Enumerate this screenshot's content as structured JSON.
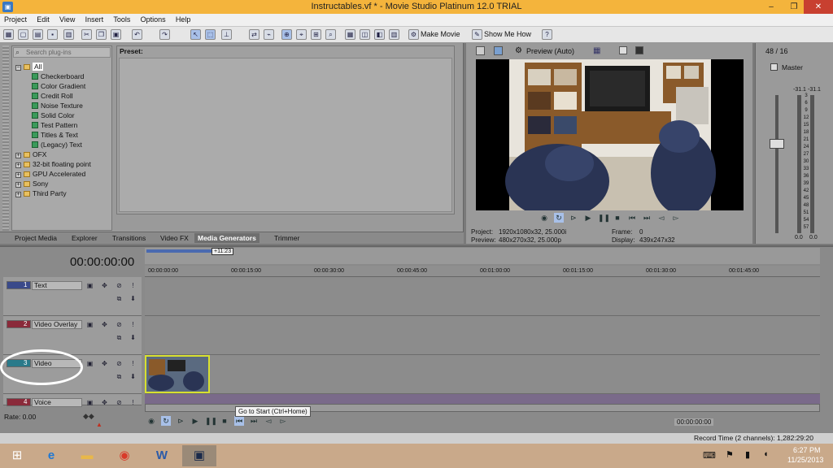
{
  "window": {
    "title": "Instructables.vf * - Movie Studio Platinum 12.0 TRIAL",
    "controls": [
      "–",
      "❐",
      "✕"
    ]
  },
  "menu": [
    "Project",
    "Edit",
    "View",
    "Insert",
    "Tools",
    "Options",
    "Help"
  ],
  "toolbar": {
    "make_movie": "Make Movie",
    "show_me_how": "Show Me How"
  },
  "plugins": {
    "search_placeholder": "Search plug-ins",
    "tree": [
      {
        "label": "All",
        "level": 0,
        "type": "folder",
        "selected": true
      },
      {
        "label": "Checkerboard",
        "level": 1,
        "type": "generator"
      },
      {
        "label": "Color Gradient",
        "level": 1,
        "type": "generator"
      },
      {
        "label": "Credit Roll",
        "level": 1,
        "type": "generator"
      },
      {
        "label": "Noise Texture",
        "level": 1,
        "type": "generator"
      },
      {
        "label": "Solid Color",
        "level": 1,
        "type": "generator"
      },
      {
        "label": "Test Pattern",
        "level": 1,
        "type": "generator"
      },
      {
        "label": "Titles & Text",
        "level": 1,
        "type": "generator"
      },
      {
        "label": "(Legacy) Text",
        "level": 1,
        "type": "generator"
      },
      {
        "label": "OFX",
        "level": 0,
        "type": "folder"
      },
      {
        "label": "32-bit floating point",
        "level": 0,
        "type": "folder"
      },
      {
        "label": "GPU Accelerated",
        "level": 0,
        "type": "folder"
      },
      {
        "label": "Sony",
        "level": 0,
        "type": "folder"
      },
      {
        "label": "Third Party",
        "level": 0,
        "type": "folder"
      }
    ]
  },
  "preset_label": "Preset:",
  "tabs": [
    "Project Media",
    "Explorer",
    "Transitions",
    "Video FX",
    "Media Generators",
    "Trimmer"
  ],
  "active_tab": "Media Generators",
  "preview": {
    "mode": "Preview (Auto)",
    "project_label": "Project:",
    "project_value": "1920x1080x32, 25.000i",
    "preview_label": "Preview:",
    "preview_value": "480x270x32, 25.000p",
    "frame_label": "Frame:",
    "frame_value": "0",
    "display_label": "Display:",
    "display_value": "439x247x32"
  },
  "mixer": {
    "channels": "48 / 16",
    "master": "Master",
    "peak_left": "-31.1",
    "peak_right": "-31.1",
    "scale": [
      "3",
      "6",
      "9",
      "12",
      "15",
      "18",
      "21",
      "24",
      "27",
      "30",
      "33",
      "36",
      "39",
      "42",
      "45",
      "48",
      "51",
      "54",
      "57"
    ],
    "bottom_left": "0.0",
    "bottom_right": "0.0"
  },
  "timeline": {
    "timecode": "00:00:00:00",
    "marker": "+11:23",
    "ruler": [
      "00:00:00:00",
      "00:00:15:00",
      "00:00:30:00",
      "00:00:45:00",
      "00:01:00:00",
      "00:01:15:00",
      "00:01:30:00",
      "00:01:45:00"
    ],
    "tracks": [
      {
        "num": "1",
        "name": "Text"
      },
      {
        "num": "2",
        "name": "Video Overlay"
      },
      {
        "num": "3",
        "name": "Video"
      },
      {
        "num": "4",
        "name": "Voice"
      }
    ],
    "rate_label": "Rate: 0.00",
    "tooltip": "Go to Start (Ctrl+Home)",
    "bottom_timecode": "00:00:00:00"
  },
  "status": {
    "record_time": "Record Time (2 channels): 1,282:29:20"
  },
  "taskbar": {
    "time": "6:27 PM",
    "date": "11/25/2013"
  },
  "colors": {
    "title_accent": "#f4b43c",
    "selected_clip_border": "#d8e030",
    "annotation_circle": "#ffffff"
  }
}
